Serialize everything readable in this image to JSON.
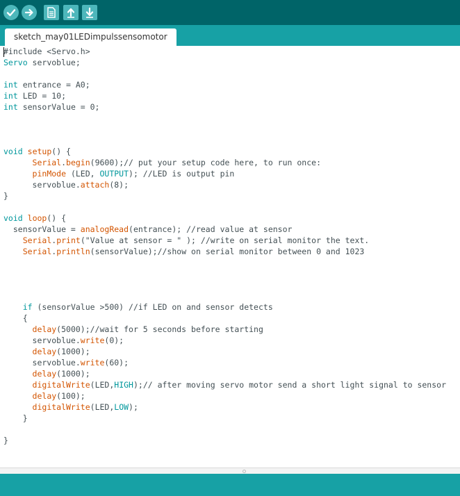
{
  "toolbar": {
    "buttons": [
      {
        "name": "verify",
        "icon": "checkmark-icon"
      },
      {
        "name": "upload",
        "icon": "arrow-right-icon"
      },
      {
        "name": "new",
        "icon": "new-file-icon"
      },
      {
        "name": "open",
        "icon": "arrow-up-icon"
      },
      {
        "name": "save",
        "icon": "arrow-down-icon"
      }
    ]
  },
  "tabs": [
    {
      "label": "sketch_may01LEDimpulssensomotor",
      "active": true
    }
  ],
  "editor": {
    "lines": [
      [
        [
          "#include <",
          ""
        ],
        [
          "Servo.h",
          ""
        ],
        [
          ">",
          ""
        ]
      ],
      [
        [
          "Servo",
          "k-type"
        ],
        [
          " servoblue;",
          ""
        ]
      ],
      [],
      [
        [
          "int",
          "k-type"
        ],
        [
          " entrance = A0;",
          ""
        ]
      ],
      [
        [
          "int",
          "k-type"
        ],
        [
          " LED = 10;",
          ""
        ]
      ],
      [
        [
          "int",
          "k-type"
        ],
        [
          " sensorValue = 0;",
          ""
        ]
      ],
      [],
      [],
      [],
      [
        [
          "void",
          "k-type"
        ],
        [
          " ",
          ""
        ],
        [
          "setup",
          "k-fn"
        ],
        [
          "() {",
          ""
        ]
      ],
      [
        [
          "      ",
          ""
        ],
        [
          "Serial",
          "k-fn"
        ],
        [
          ".",
          ""
        ],
        [
          "begin",
          "k-fn"
        ],
        [
          "(9600);// put your setup code here, to run once:",
          ""
        ]
      ],
      [
        [
          "      ",
          ""
        ],
        [
          "pinMode",
          "k-fn"
        ],
        [
          " (LED, ",
          ""
        ],
        [
          "OUTPUT",
          "k-const"
        ],
        [
          "); //LED is output pin",
          ""
        ]
      ],
      [
        [
          "      servoblue.",
          ""
        ],
        [
          "attach",
          "k-fn"
        ],
        [
          "(8);",
          ""
        ]
      ],
      [
        [
          "}",
          ""
        ]
      ],
      [],
      [
        [
          "void",
          "k-type"
        ],
        [
          " ",
          ""
        ],
        [
          "loop",
          "k-fn"
        ],
        [
          "() {",
          ""
        ]
      ],
      [
        [
          "  sensorValue = ",
          ""
        ],
        [
          "analogRead",
          "k-fn"
        ],
        [
          "(entrance); //read value at sensor",
          ""
        ]
      ],
      [
        [
          "    ",
          ""
        ],
        [
          "Serial",
          "k-fn"
        ],
        [
          ".",
          ""
        ],
        [
          "print",
          "k-fn"
        ],
        [
          "(\"Value at sensor = \" ); //write on serial monitor the text.",
          ""
        ]
      ],
      [
        [
          "    ",
          ""
        ],
        [
          "Serial",
          "k-fn"
        ],
        [
          ".",
          ""
        ],
        [
          "println",
          "k-fn"
        ],
        [
          "(sensorValue);//show on serial monitor between 0 and 1023",
          ""
        ]
      ],
      [],
      [],
      [],
      [],
      [
        [
          "    ",
          ""
        ],
        [
          "if",
          "k-type"
        ],
        [
          " (sensorValue >500) //if LED on and sensor detects",
          ""
        ]
      ],
      [
        [
          "    {",
          ""
        ]
      ],
      [
        [
          "      ",
          ""
        ],
        [
          "delay",
          "k-fn"
        ],
        [
          "(5000);//wait for 5 seconds before starting",
          ""
        ]
      ],
      [
        [
          "      servoblue.",
          ""
        ],
        [
          "write",
          "k-fn"
        ],
        [
          "(0);",
          ""
        ]
      ],
      [
        [
          "      ",
          ""
        ],
        [
          "delay",
          "k-fn"
        ],
        [
          "(1000);",
          ""
        ]
      ],
      [
        [
          "      servoblue.",
          ""
        ],
        [
          "write",
          "k-fn"
        ],
        [
          "(60);",
          ""
        ]
      ],
      [
        [
          "      ",
          ""
        ],
        [
          "delay",
          "k-fn"
        ],
        [
          "(1000);",
          ""
        ]
      ],
      [
        [
          "      ",
          ""
        ],
        [
          "digitalWrite",
          "k-fn"
        ],
        [
          "(LED,",
          ""
        ],
        [
          "HIGH",
          "k-const"
        ],
        [
          ");// after moving servo motor send a short light signal to sensor",
          ""
        ]
      ],
      [
        [
          "      ",
          ""
        ],
        [
          "delay",
          "k-fn"
        ],
        [
          "(100);",
          ""
        ]
      ],
      [
        [
          "      ",
          ""
        ],
        [
          "digitalWrite",
          "k-fn"
        ],
        [
          "(LED,",
          ""
        ],
        [
          "LOW",
          "k-const"
        ],
        [
          ");",
          ""
        ]
      ],
      [
        [
          "    }",
          ""
        ]
      ],
      [],
      [
        [
          "}",
          ""
        ]
      ]
    ]
  },
  "colors": {
    "toolbar": "#006468",
    "tabbar": "#17a1a5",
    "keyword": "#00979c",
    "function": "#d35400",
    "text": "#434f54"
  }
}
